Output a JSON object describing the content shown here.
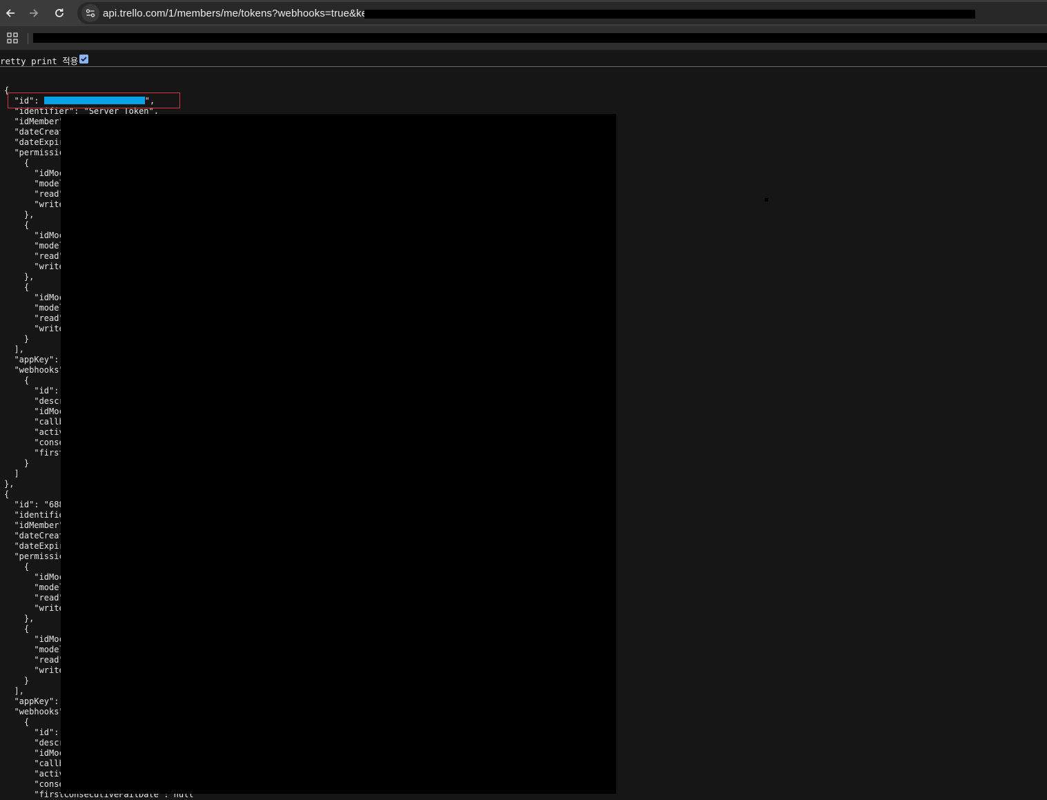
{
  "browser": {
    "url": "api.trello.com/1/members/me/tokens?webhooks=true&key=",
    "icons": [
      "back-arrow-icon",
      "forward-arrow-icon",
      "reload-icon",
      "site-info-icon",
      "apps-grid-icon"
    ]
  },
  "pretty_print": {
    "label": "retty print 적용",
    "checked": true
  },
  "json_lines": [
    "{",
    "  \"id\": ",
    "  \"identifier\": \"Server Token\",",
    "  \"idMember\"",
    "  \"dateCreat",
    "  \"dateExpir",
    "  \"permissic",
    "    {",
    "      \"idMoc",
    "      \"model",
    "      \"read\"",
    "      \"write",
    "    },",
    "    {",
    "      \"idMoc",
    "      \"model",
    "      \"read\"",
    "      \"write",
    "    },",
    "    {",
    "      \"idMoc",
    "      \"model",
    "      \"read\"",
    "      \"write",
    "    }",
    "  ],",
    "  \"appKey\":",
    "  \"webhooks\"",
    "    {",
    "      \"id\":",
    "      \"descr",
    "      \"idMoc",
    "      \"callb",
    "      \"activ",
    "      \"conse",
    "      \"first",
    "    }",
    "  ]",
    "},",
    "{",
    "  \"id\": \"688",
    "  \"identifie",
    "  \"idMember\"",
    "  \"dateCreat",
    "  \"dateExpir",
    "  \"permissic",
    "    {",
    "      \"idMoc",
    "      \"model",
    "      \"read\"",
    "      \"write",
    "    },",
    "    {",
    "      \"idMoc",
    "      \"model",
    "      \"read\"",
    "      \"write",
    "    }",
    "  ],",
    "  \"appKey\":",
    "  \"webhooks\"",
    "    {",
    "      \"id\":",
    "      \"descr",
    "      \"idMoc",
    "      \"callb",
    "      \"activ",
    "      \"conse",
    "      \"firstConsecutiveFailDate\": null"
  ],
  "id_line_suffix": "\","
}
